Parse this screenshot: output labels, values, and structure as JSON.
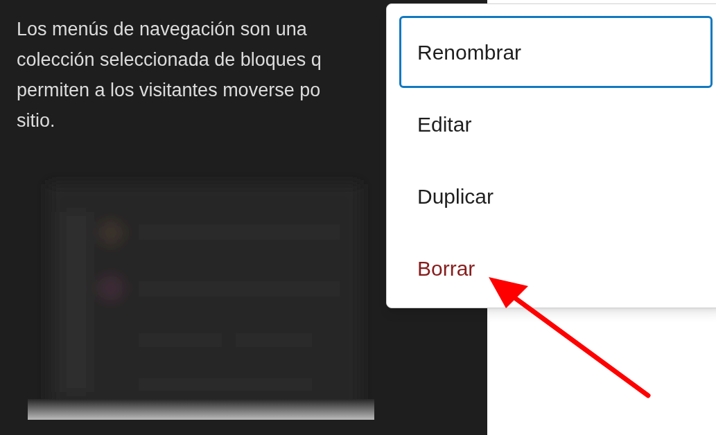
{
  "description": {
    "lines": [
      "Los menús de navegación son una",
      "colección seleccionada de bloques q",
      "permiten a los visitantes moverse po",
      "sitio."
    ]
  },
  "menu": {
    "items": [
      {
        "label": "Renombrar",
        "kind": "normal",
        "selected": true
      },
      {
        "label": "Editar",
        "kind": "normal",
        "selected": false
      },
      {
        "label": "Duplicar",
        "kind": "normal",
        "selected": false
      },
      {
        "label": "Borrar",
        "kind": "danger",
        "selected": false
      }
    ]
  }
}
